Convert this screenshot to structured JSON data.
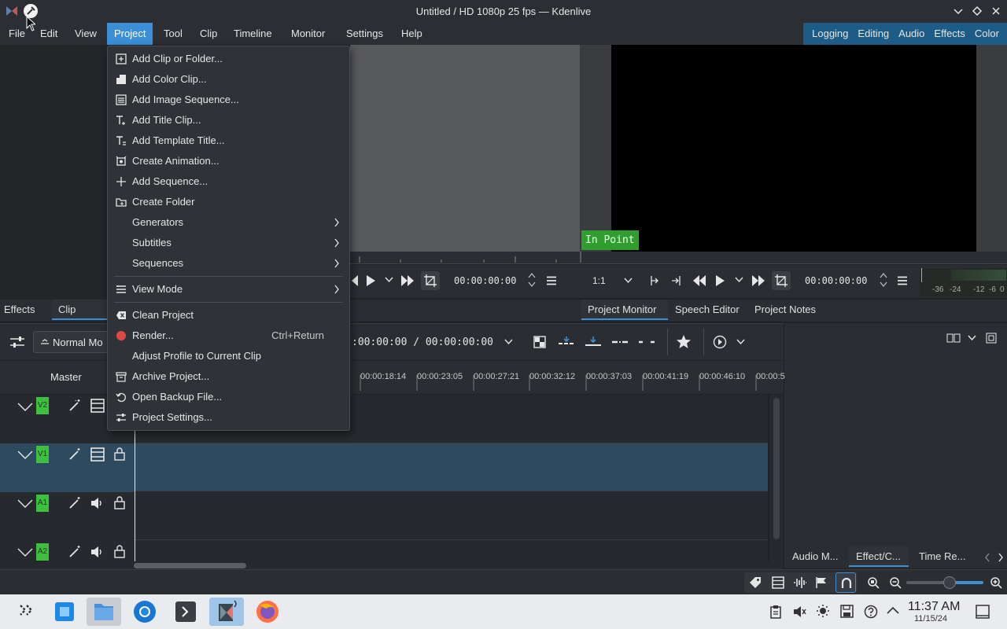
{
  "window": {
    "title": "Untitled / HD 1080p 25 fps — Kdenlive"
  },
  "menubar": {
    "items": [
      "File",
      "Edit",
      "View",
      "Project",
      "Tool",
      "Clip",
      "Timeline",
      "Monitor",
      "Settings",
      "Help"
    ],
    "active": "Project",
    "workspaces": [
      "Logging",
      "Editing",
      "Audio",
      "Effects",
      "Color"
    ]
  },
  "project_menu": {
    "items": [
      {
        "label": "Add Clip or Folder...",
        "icon": "add-clip-icon"
      },
      {
        "label": "Add Color Clip...",
        "icon": "color-clip-icon"
      },
      {
        "label": "Add Image Sequence...",
        "icon": "image-sequence-icon"
      },
      {
        "label": "Add Title Clip...",
        "icon": "title-clip-icon"
      },
      {
        "label": "Add Template Title...",
        "icon": "template-title-icon"
      },
      {
        "label": "Create Animation...",
        "icon": "animation-icon"
      },
      {
        "label": "Add Sequence...",
        "icon": "plus-icon"
      },
      {
        "label": "Create Folder",
        "icon": "folder-icon"
      },
      {
        "label": "Generators",
        "submenu": true
      },
      {
        "label": "Subtitles",
        "submenu": true
      },
      {
        "label": "Sequences",
        "submenu": true
      },
      {
        "label": "View Mode",
        "icon": "view-mode-icon",
        "submenu": true
      },
      {
        "label": "Clean Project",
        "icon": "clean-icon"
      },
      {
        "label": "Render...",
        "icon": "render-icon",
        "shortcut": "Ctrl+Return"
      },
      {
        "label": "Adjust Profile to Current Clip"
      },
      {
        "label": "Archive Project...",
        "icon": "archive-icon"
      },
      {
        "label": "Open Backup File...",
        "icon": "backup-icon"
      },
      {
        "label": "Project Settings...",
        "icon": "settings-icon"
      }
    ]
  },
  "clip_monitor": {
    "timecode": "00:00:00:00"
  },
  "project_monitor": {
    "in_point_label": "In Point",
    "zoom": "1:1",
    "timecode": "00:00:00:00",
    "meter_labels": [
      "-36",
      "-24",
      "-12",
      "-6",
      "0"
    ]
  },
  "left_tabs": [
    "Effects",
    "Clip Pro..."
  ],
  "monitor_tabs": [
    "Project Monitor",
    "Speech Editor",
    "Project Notes"
  ],
  "timeline": {
    "mode": "Normal Mo",
    "position": ":00:00:00 / 00:00:00:00",
    "master_label": "Master",
    "ruler": [
      "00:00:18:14",
      "00:00:23:05",
      "00:00:27:21",
      "00:00:32:12",
      "00:00:37:03",
      "00:00:41:19",
      "00:00:46:10",
      "00:00:5"
    ],
    "tracks": [
      "V2",
      "V1",
      "A1",
      "A2"
    ]
  },
  "right_bottom_tabs": [
    "Audio M...",
    "Effect/C...",
    "Time Re..."
  ],
  "taskbar": {
    "time": "11:37 AM",
    "date": "11/15/24"
  },
  "colors": {
    "accent": "#3a8fd6",
    "track_tag": "#3fbf3f",
    "in_point": "#2f9e2f",
    "render_dot": "#e04848"
  }
}
